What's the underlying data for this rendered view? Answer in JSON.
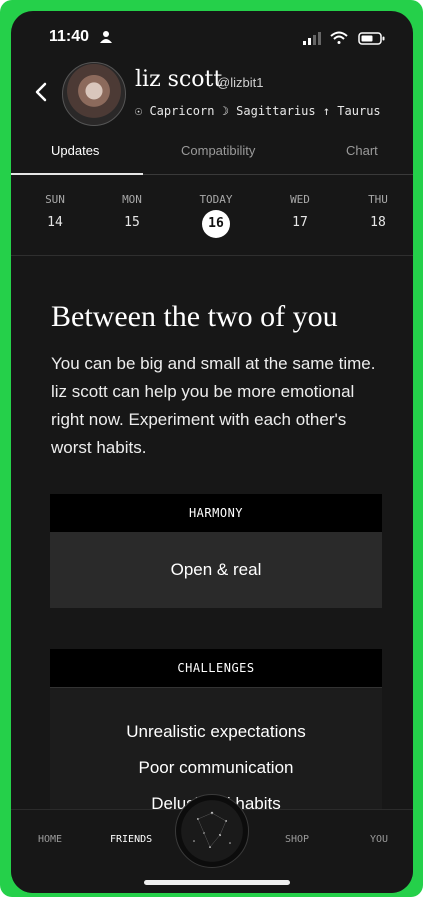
{
  "status_bar": {
    "time": "11:40"
  },
  "profile": {
    "name": "liz scott",
    "handle": "@lizbit1",
    "signs": "☉ Capricorn ☽ Sagittarius ↑ Taurus"
  },
  "tabs": [
    {
      "label": "Updates",
      "active": true
    },
    {
      "label": "Compatibility",
      "active": false
    },
    {
      "label": "Chart",
      "active": false
    }
  ],
  "days": [
    {
      "name": "SUN",
      "num": "14"
    },
    {
      "name": "MON",
      "num": "15"
    },
    {
      "name": "TODAY",
      "num": "16",
      "today": true
    },
    {
      "name": "WED",
      "num": "17"
    },
    {
      "name": "THU",
      "num": "18"
    }
  ],
  "content": {
    "title": "Between the two of you",
    "body": "You can be big and small at the same time. liz scott can help you be more emotional right now. Experiment with each other's worst habits.",
    "harmony": {
      "label": "HARMONY",
      "value": "Open & real"
    },
    "challenges": {
      "label": "CHALLENGES",
      "items": [
        "Unrealistic expectations",
        "Poor communication",
        "Delusional habits"
      ]
    }
  },
  "bottom_nav": [
    {
      "label": "HOME",
      "active": false
    },
    {
      "label": "FRIENDS",
      "active": true
    },
    {
      "label": "SHOP",
      "active": false
    },
    {
      "label": "YOU",
      "active": false
    }
  ],
  "colors": {
    "frame": "#25d04a",
    "background": "#171717",
    "card": "#2a2a2a"
  }
}
